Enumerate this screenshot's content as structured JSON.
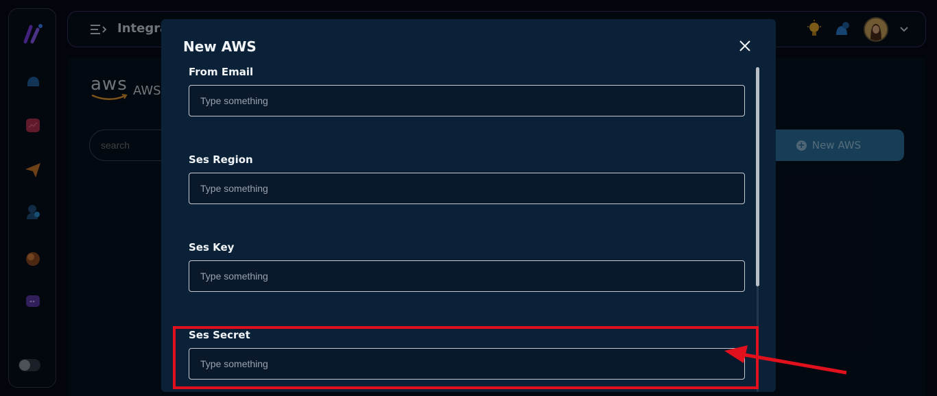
{
  "header": {
    "page_title": "Integra"
  },
  "page": {
    "logo_text": "aws",
    "heading": "AWS",
    "search_placeholder": "search",
    "new_button_label": "New AWS"
  },
  "modal": {
    "title": "New AWS",
    "fields": [
      {
        "label": "From Email",
        "placeholder": "Type something"
      },
      {
        "label": "Ses Region",
        "placeholder": "Type something"
      },
      {
        "label": "Ses Key",
        "placeholder": "Type something"
      },
      {
        "label": "Ses Secret",
        "placeholder": "Type something"
      }
    ]
  },
  "colors": {
    "accent_purple": "#7b3fe4",
    "button_blue": "#2a6f9f",
    "highlight_red": "#e0101c"
  },
  "icons": [
    "app-logo-icon",
    "dashboard-icon",
    "analytics-icon",
    "send-icon",
    "users-icon",
    "sphere-icon",
    "chat-icon",
    "menu-icon",
    "lightbulb-icon",
    "notification-icon",
    "chevron-down-icon",
    "close-icon",
    "plus-icon"
  ]
}
